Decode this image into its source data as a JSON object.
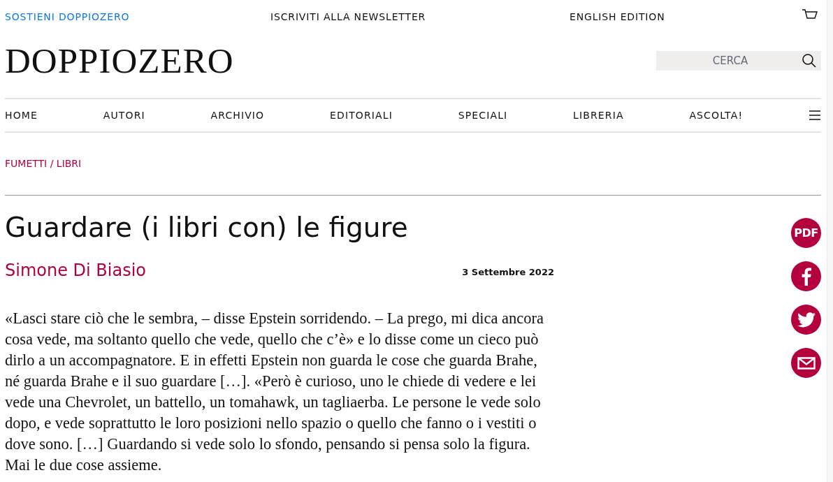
{
  "top_bar": {
    "support_link": "SOSTIENI DOPPIOZERO",
    "newsletter_link": "ISCRIVITI ALLA NEWSLETTER",
    "english_link": "ENGLISH EDITION"
  },
  "logo": "DOPPIOZERO",
  "search": {
    "placeholder": "CERCA"
  },
  "nav": [
    {
      "label": "HOME"
    },
    {
      "label": "AUTORI"
    },
    {
      "label": "ARCHIVIO"
    },
    {
      "label": "EDITORIALI"
    },
    {
      "label": "SPECIALI"
    },
    {
      "label": "LIBRERIA"
    },
    {
      "label": "ASCOLTA!"
    }
  ],
  "breadcrumb": "FUMETTI / LIBRI",
  "article": {
    "title": "Guardare (i libri con) le figure",
    "author": "Simone Di Biasio",
    "date": "3 Settembre 2022",
    "body": "«Lasci stare ciò che le sembra, – disse Epstein sorridendo. – La prego, mi dica ancora cosa vede, ma soltanto quello che vede, quello che c’è» e lo disse come un cieco può dirlo a un accompagnatore. E in effetti Epstein non guarda le cose che guarda Brahe, né guarda Brahe e il suo guardare […]. «Però è curioso, uno le chiede di vedere e lei vede una Chevrolet, un battello, un tomahawk, un tagliaerba. Le persone le vede solo dopo, e vede soprattutto le loro posizioni nello spazio o quello che fanno o i vestiti o dove sono. […] Guardando si vede solo lo sfondo, pensando si pensa solo la figura. Mai le due cose assieme."
  },
  "share": [
    {
      "kind": "pdf",
      "label": "PDF"
    },
    {
      "kind": "facebook"
    },
    {
      "kind": "twitter"
    },
    {
      "kind": "email"
    }
  ]
}
